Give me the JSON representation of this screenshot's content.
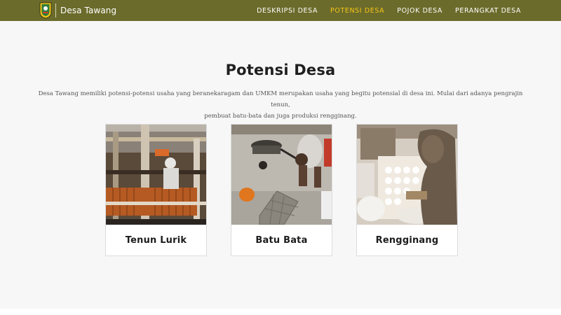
{
  "site": {
    "name": "Desa Tawang",
    "logo": "village-emblem-logo"
  },
  "nav": {
    "items": [
      {
        "label": "DESKRIPSI DESA",
        "active": false
      },
      {
        "label": "POTENSI DESA",
        "active": true
      },
      {
        "label": "POJOK DESA",
        "active": false
      },
      {
        "label": "PERANGKAT DESA",
        "active": false
      }
    ]
  },
  "section": {
    "title": "Potensi Desa",
    "description_line1": "Desa Tawang memiliki potensi-potensi usaha yang beranekaragam dan UMKM merupakan usaha yang begitu potensial di desa ini. Mulai dari adanya pengrajin tenun,",
    "description_line2": "pembuat batu-bata dan juga produksi rengginang."
  },
  "cards": [
    {
      "title": "Tenun Lurik",
      "image": "weaving-loom-photo"
    },
    {
      "title": "Batu Bata",
      "image": "brick-making-photo"
    },
    {
      "title": "Rengginang",
      "image": "rengginang-making-photo"
    }
  ],
  "colors": {
    "navbar": "#6b6b2b",
    "nav_active": "#f5c518",
    "section_bg": "#f7f7f8",
    "title": "#1f1f1f",
    "text": "#555555"
  }
}
